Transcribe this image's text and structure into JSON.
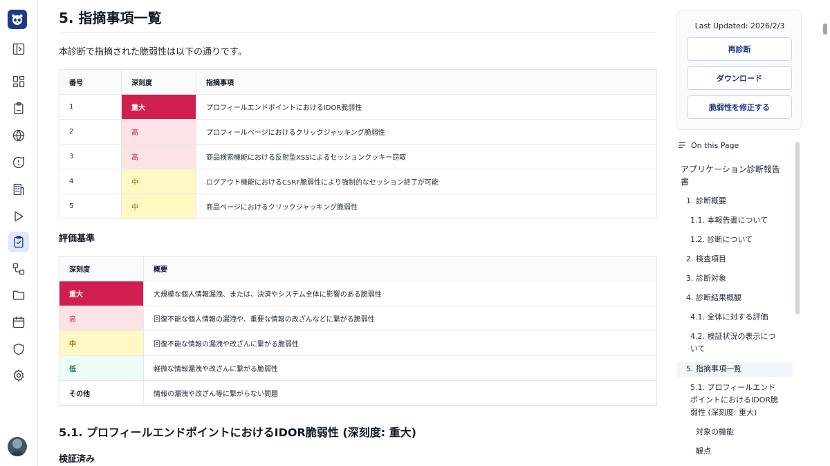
{
  "rail": {
    "icons": [
      "sidebar-toggle-icon",
      "dashboard-icon",
      "clipboard-icon",
      "globe-icon",
      "chat-icon",
      "building-icon",
      "play-icon",
      "checklist-icon",
      "workflow-icon",
      "folder-icon",
      "calendar-icon",
      "shield-icon",
      "gear-icon"
    ],
    "active": "checklist-icon"
  },
  "main": {
    "title": "5. 指摘事項一覧",
    "intro": "本診断で指摘された脆弱性は以下の通りです。",
    "findings_table": {
      "headers": [
        "番号",
        "深刻度",
        "指摘事項"
      ],
      "rows": [
        {
          "no": "1",
          "severity": "重大",
          "level": "critical",
          "item": "プロフィールエンドポイントにおけるIDOR脆弱性"
        },
        {
          "no": "2",
          "severity": "高",
          "level": "high",
          "item": "プロフィールページにおけるクリックジャッキング脆弱性"
        },
        {
          "no": "3",
          "severity": "高",
          "level": "high",
          "item": "商品検索機能における反射型XSSによるセッションクッキー窃取"
        },
        {
          "no": "4",
          "severity": "中",
          "level": "mid",
          "item": "ログアウト機能におけるCSRF脆弱性により強制的なセッション終了が可能"
        },
        {
          "no": "5",
          "severity": "中",
          "level": "mid",
          "item": "商品ページにおけるクリックジャッキング脆弱性"
        }
      ]
    },
    "criteria_title": "評価基準",
    "criteria_table": {
      "headers": [
        "深刻度",
        "概要"
      ],
      "rows": [
        {
          "severity": "重大",
          "level": "critical",
          "desc": "大規模な個人情報漏洩、または、決済やシステム全体に影響のある脆弱性"
        },
        {
          "severity": "高",
          "level": "high",
          "desc": "回復不能な個人情報の漏洩や、重要な情報の改ざんなどに繋がる脆弱性"
        },
        {
          "severity": "中",
          "level": "mid",
          "desc": "回復不能な情報の漏洩や改ざんに繋がる脆弱性"
        },
        {
          "severity": "低",
          "level": "low",
          "desc": "軽微な情報漏洩や改ざんに繋がる脆弱性"
        },
        {
          "severity": "その他",
          "level": "other",
          "desc": "情報の漏洩や改ざん等に繋がらない問題"
        }
      ]
    },
    "subsection_title": "5.1. プロフィールエンドポイントにおけるIDOR脆弱性 (深刻度: 重大)",
    "subsubsection_title": "検証済み"
  },
  "panel": {
    "last_updated": "Last Updated: 2026/2/3",
    "buttons": [
      "再診断",
      "ダウンロード",
      "脆弱性を修正する"
    ]
  },
  "toc": {
    "heading": "On this Page",
    "items": [
      {
        "label": "アプリケーション診断報告",
        "level": 0
      },
      {
        "label": "書",
        "level": 0
      },
      {
        "label": "1. 診断概要",
        "level": 1
      },
      {
        "label": "1.1. 本報告書について",
        "level": 2
      },
      {
        "label": "1.2. 診断について",
        "level": 2
      },
      {
        "label": "2. 検査項目",
        "level": 1
      },
      {
        "label": "3. 診断対象",
        "level": 1
      },
      {
        "label": "4. 診断結果概観",
        "level": 1
      },
      {
        "label": "4.1. 全体に対する評価",
        "level": 2
      },
      {
        "label": "4.2. 検証状況の表示につ",
        "level": 2
      },
      {
        "label": "いて",
        "level": 2
      },
      {
        "label": "5. 指摘事項一覧",
        "level": 1,
        "active": true
      },
      {
        "label": "5.1. プロフィールエンド",
        "level": 2
      },
      {
        "label": "ポイントにおけるIDOR脆",
        "level": 2
      },
      {
        "label": "弱性 (深刻度: 重大)",
        "level": 2
      },
      {
        "label": "対象の機能",
        "level": 3
      },
      {
        "label": "観点",
        "level": 3
      }
    ]
  }
}
